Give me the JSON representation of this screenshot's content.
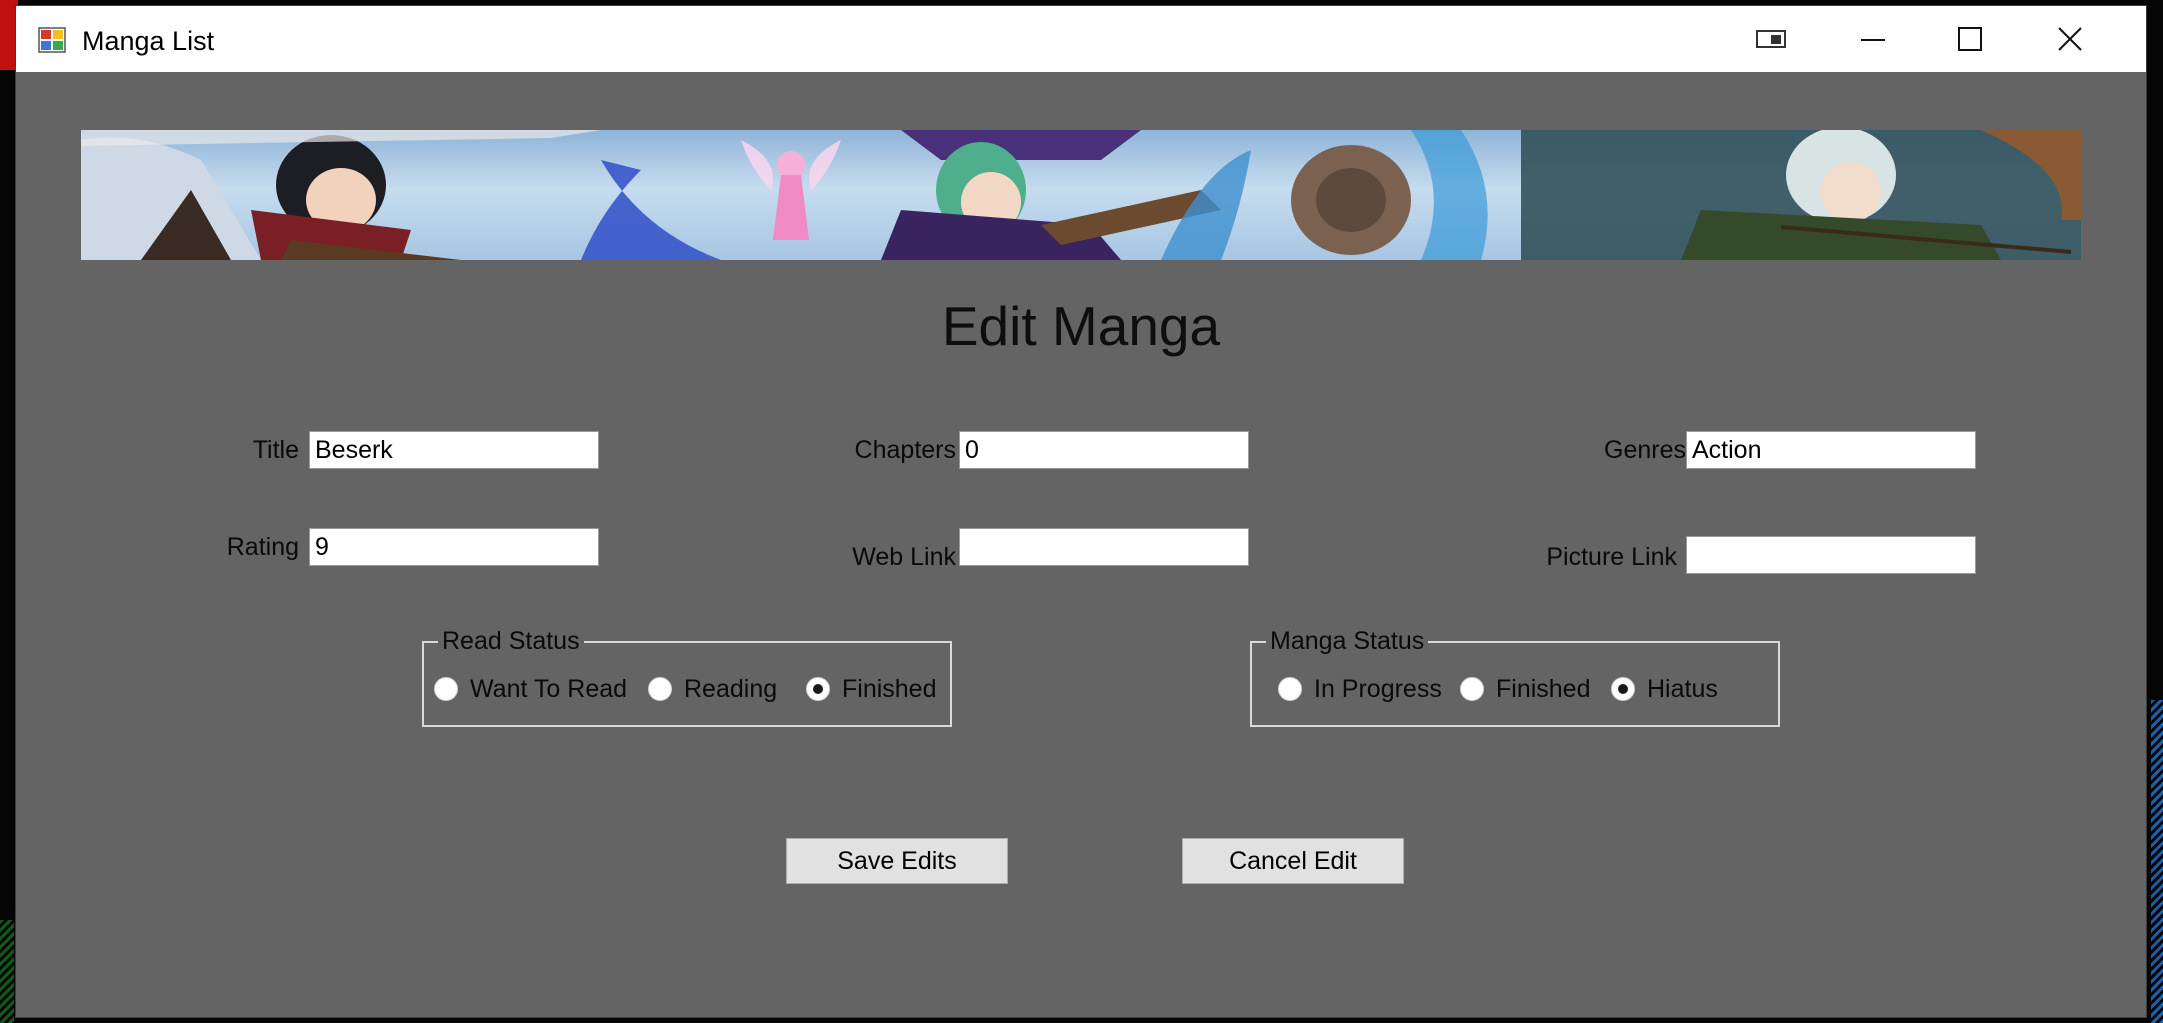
{
  "window": {
    "title": "Manga List",
    "controls": [
      "restore-snap",
      "minimize",
      "maximize",
      "close"
    ]
  },
  "form": {
    "heading": "Edit Manga",
    "fields": {
      "title": {
        "label": "Title",
        "value": "Beserk"
      },
      "chapters": {
        "label": "Chapters",
        "value": "0"
      },
      "genres": {
        "label": "Genres",
        "value": "Action"
      },
      "rating": {
        "label": "Rating",
        "value": "9"
      },
      "web_link": {
        "label": "Web Link",
        "value": ""
      },
      "picture_link": {
        "label": "Picture Link",
        "value": ""
      }
    },
    "read_status": {
      "legend": "Read Status",
      "options": [
        "Want To Read",
        "Reading",
        "Finished"
      ],
      "selected": "Finished"
    },
    "manga_status": {
      "legend": "Manga Status",
      "options": [
        "In Progress",
        "Finished",
        "Hiatus"
      ],
      "selected": "Hiatus"
    },
    "buttons": {
      "save": "Save Edits",
      "cancel": "Cancel Edit"
    }
  },
  "colors": {
    "form_background": "#646464",
    "titlebar": "#ffffff",
    "button_face": "#e1e1e1"
  }
}
